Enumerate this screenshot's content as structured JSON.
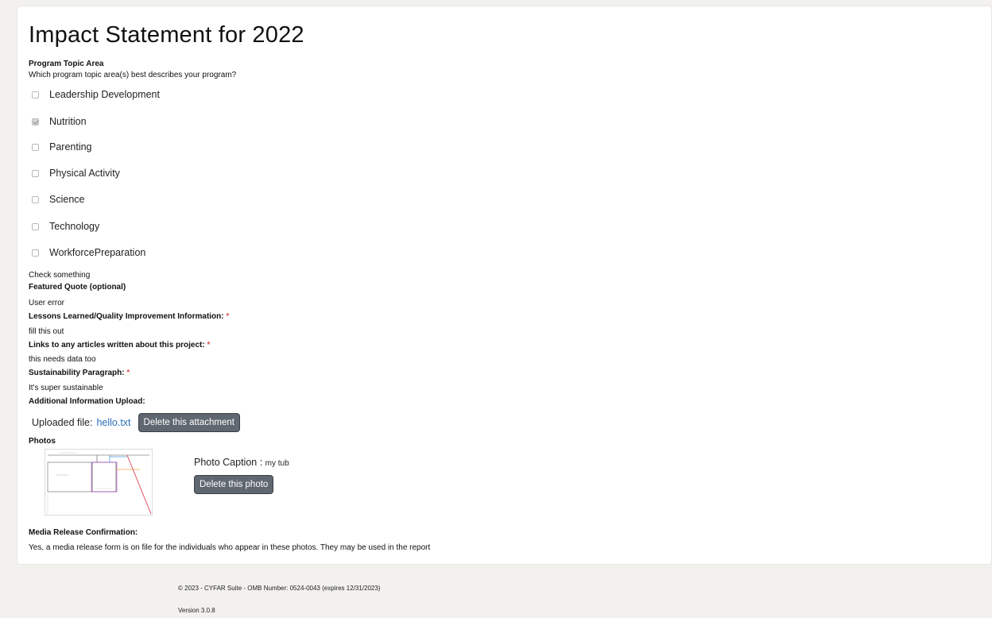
{
  "page": {
    "title": "Impact Statement for 2022"
  },
  "topic_area": {
    "heading": "Program Topic Area",
    "question": "Which program topic area(s) best describes your program?",
    "options": [
      {
        "label": "Leadership Development",
        "checked": false
      },
      {
        "label": "Nutrition",
        "checked": true
      },
      {
        "label": "Parenting",
        "checked": false
      },
      {
        "label": "Physical Activity",
        "checked": false
      },
      {
        "label": "Science",
        "checked": false
      },
      {
        "label": "Technology",
        "checked": false
      },
      {
        "label": "WorkforcePreparation",
        "checked": false
      }
    ],
    "note": "Check something"
  },
  "fields": {
    "featured_quote": {
      "label": "Featured Quote (optional)",
      "value": "User error"
    },
    "lessons": {
      "label": "Lessons Learned/Quality Improvement Information:",
      "required": "*",
      "value": "fill this out"
    },
    "links": {
      "label": "Links to any articles written about this project:",
      "required": "*",
      "value": "this needs data too"
    },
    "sustainability": {
      "label": "Sustainability Paragraph:",
      "required": "*",
      "value": "It's super sustainable"
    },
    "upload": {
      "label": "Additional Information Upload:"
    }
  },
  "attachment": {
    "prefix": "Uploaded file:",
    "filename": "hello.txt",
    "delete_label": "Delete this attachment"
  },
  "photos": {
    "heading": "Photos",
    "caption_label": "Photo Caption :",
    "caption_value": "my tub",
    "delete_label": "Delete this photo"
  },
  "media_release": {
    "heading": "Media Release Confirmation:",
    "text": "Yes, a media release form is on file for the individuals who appear in these photos. They may be used in the report"
  },
  "footer": {
    "copyright": "© 2023 - CYFAR Suite - OMB Number: 0524-0043 (expires 12/31/2023)",
    "version": "Version 3.0.8"
  }
}
